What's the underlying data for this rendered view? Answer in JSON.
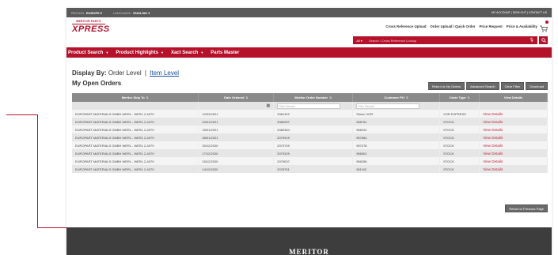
{
  "topbar": {
    "region_label": "REGION:",
    "region_value": "EUROPE",
    "language_label": "LANGUAGE:",
    "language_value": "ENGLISH",
    "account_links": "MY ACCOUNT | SIGN OUT | CONTACT US"
  },
  "brand": {
    "logo_top": "MERITOR PARTS",
    "logo_main": "XPRESS",
    "accent_color": "#b5112b"
  },
  "header_links": [
    "Cross Reference Upload",
    "Order Upload / Quick Order",
    "Price Request",
    "Price & Availability"
  ],
  "search": {
    "scope": "All",
    "placeholder": "Search / Cross Reference Lookup"
  },
  "nav": [
    {
      "label": "Product Search",
      "icon": "chevron-down-icon"
    },
    {
      "label": "Product Highlights",
      "icon": "chevron-down-icon"
    },
    {
      "label": "Xact Search",
      "icon": "chevron-down-icon"
    },
    {
      "label": "Parts Master",
      "icon": ""
    }
  ],
  "display_by": {
    "label": "Display By:",
    "option_active": "Order Level",
    "separator": "|",
    "option_link": "Item Level"
  },
  "page_title": "My Open Orders",
  "actions": [
    "Return to My Orders",
    "Advanced Search",
    "Clear Filter",
    "Download"
  ],
  "table": {
    "columns": [
      "Meritor Ship To",
      "Date Ordered",
      "Meritor Order Number",
      "Customer PO",
      "Order Type",
      "View Details"
    ],
    "filter_placeholder": "Filter Results",
    "rows": [
      {
        "ship_to": "EUROPART MATERIALS GMBH WERL - WERL 2-4079",
        "date": "12/03/2021",
        "order": "2081322",
        "po": "Simon VOR",
        "type": "VOR EXPRESS",
        "action": "View Details"
      },
      {
        "ship_to": "EUROPART MATERIALS GMBH WERL - WERL 2-4079",
        "date": "20/01/2021",
        "order": "2080997",
        "po": "958751",
        "type": "STOCK",
        "action": "View Details"
      },
      {
        "ship_to": "EUROPART MATERIALS GMBH WERL - WERL 2-4079",
        "date": "15/01/2021",
        "order": "2080364",
        "po": "958191",
        "type": "STOCK",
        "action": "View Details"
      },
      {
        "ship_to": "EUROPART MATERIALS GMBH WERL - WERL 2-4079",
        "date": "08/01/2021",
        "order": "2079919",
        "po": "957664",
        "type": "STOCK",
        "action": "View Details"
      },
      {
        "ship_to": "EUROPART MATERIALS GMBH WERL - WERL 2-4079",
        "date": "30/12/2020",
        "order": "2079709",
        "po": "957278",
        "type": "STOCK",
        "action": "View Details"
      },
      {
        "ship_to": "EUROPART MATERIALS GMBH WERL - WERL 2-4079",
        "date": "17/12/2020",
        "order": "2079329",
        "po": "956501",
        "type": "STOCK",
        "action": "View Details"
      },
      {
        "ship_to": "EUROPART MATERIALS GMBH WERL - WERL 2-4079",
        "date": "15/12/2020",
        "order": "2079007",
        "po": "956256",
        "type": "STOCK",
        "action": "View Details"
      },
      {
        "ship_to": "EUROPART MATERIALS GMBH WERL - WERL 2-4079",
        "date": "14/12/2020",
        "order": "2078751",
        "po": "951192",
        "type": "STOCK",
        "action": "View Details"
      }
    ]
  },
  "return_button": "Return to Previous Page",
  "footer": {
    "logo_text": "MERITOR"
  }
}
